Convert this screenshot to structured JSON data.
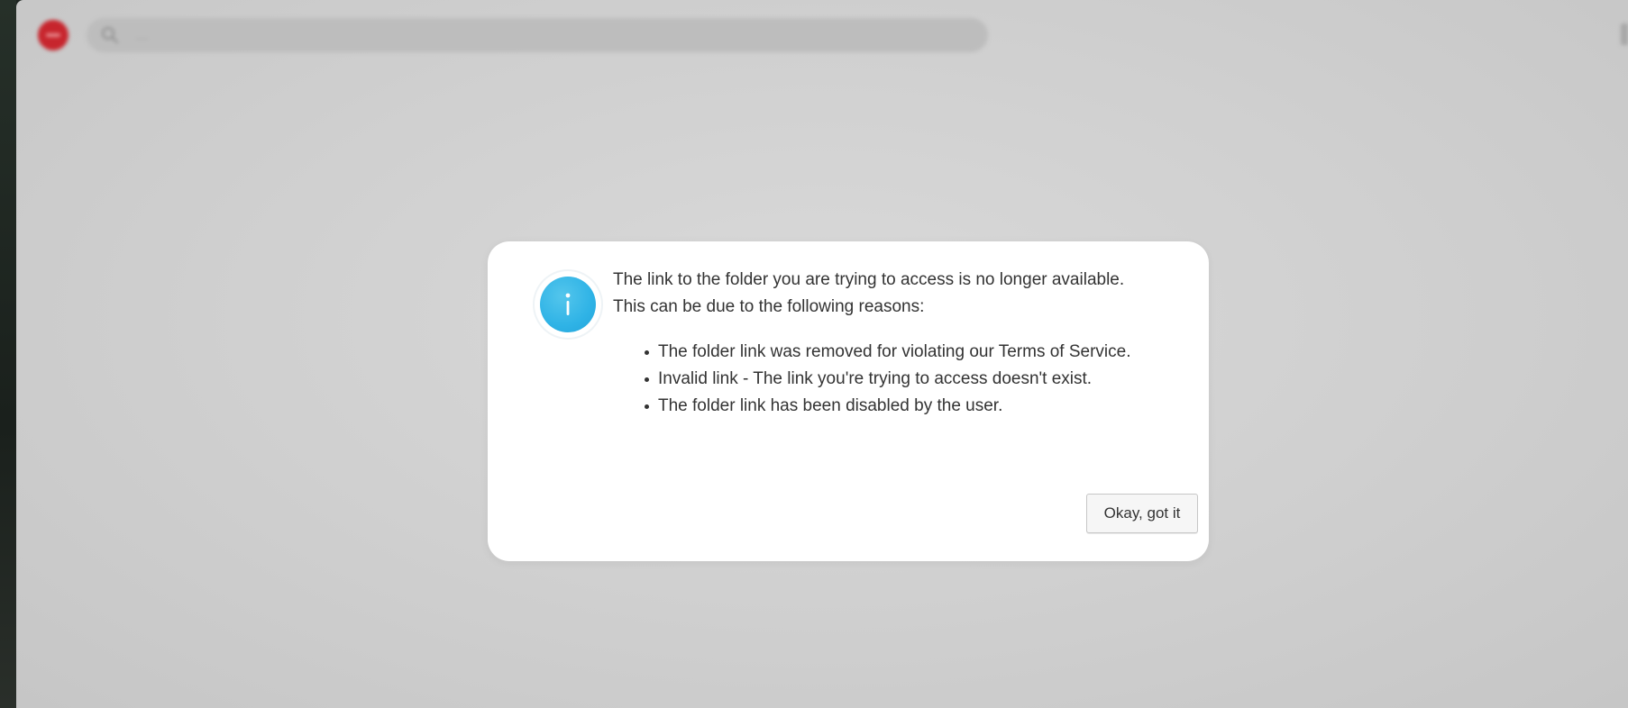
{
  "search": {
    "placeholder": "…",
    "icon": "search-icon"
  },
  "brand": {
    "icon": "brand-logo-icon",
    "color": "#c7252d"
  },
  "dialog": {
    "icon": "info-icon",
    "icon_color": "#2fb3e6",
    "message": "The link to the folder you are trying to access is no longer available. This can be due to the following reasons:",
    "reasons": [
      "The folder link was removed for violating our Terms of Service.",
      "Invalid link - The link you're trying to access doesn't exist.",
      "The folder link has been disabled by the user."
    ],
    "confirm_label": "Okay, got it"
  }
}
